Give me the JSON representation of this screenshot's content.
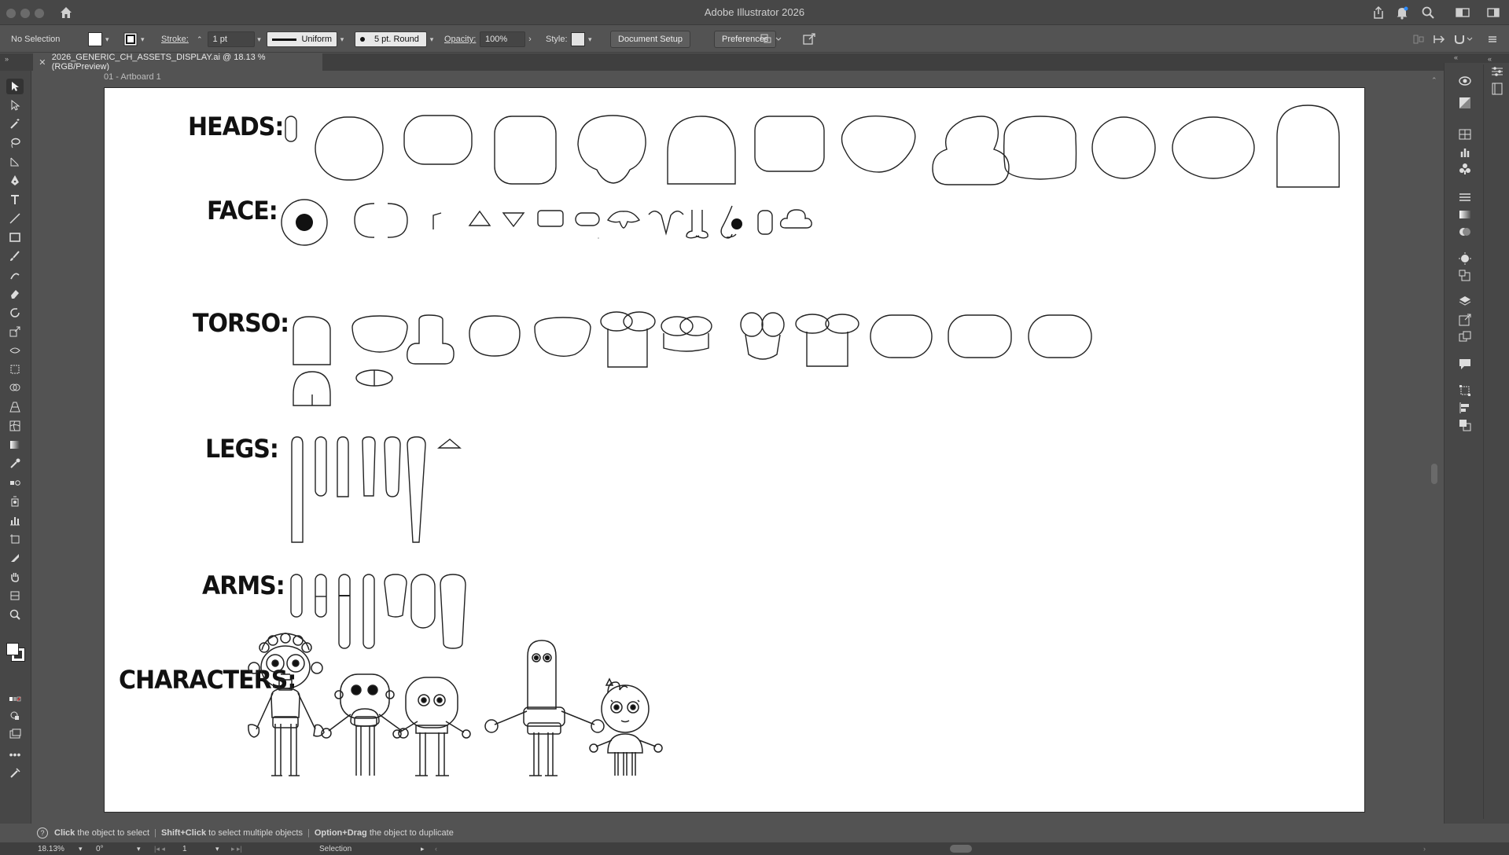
{
  "window": {
    "title": "Adobe Illustrator 2026"
  },
  "controlbar": {
    "selection": "No Selection",
    "stroke_label": "Stroke:",
    "stroke_weight": "1 pt",
    "profile": "Uniform",
    "brush": "5 pt. Round",
    "opacity_label": "Opacity:",
    "opacity_value": "100%",
    "style_label": "Style:",
    "document_setup": "Document Setup",
    "preferences": "Preferences"
  },
  "document": {
    "tab_title": "2026_GENERIC_CH_ASSETS_DISPLAY.ai @ 18.13 % (RGB/Preview)",
    "artboard_label": "01 - Artboard 1"
  },
  "artboard": {
    "categories": {
      "heads": "HEADS:",
      "face": "FACE:",
      "torso": "TORSO:",
      "legs": "LEGS:",
      "arms": "ARMS:",
      "characters": "CHARACTERS:"
    }
  },
  "hint": {
    "part1_bold": "Click",
    "part1": " the object to select",
    "part2_bold": "Shift+Click",
    "part2": " to select multiple objects",
    "part3_bold": "Option+Drag",
    "part3": " the object to duplicate"
  },
  "status": {
    "zoom": "18.13%",
    "rotation": "0°",
    "artboard_number": "1",
    "tool": "Selection"
  },
  "icons": [
    "home-icon",
    "share-icon",
    "bell-icon",
    "search-icon",
    "workspace-icon",
    "selection-tool-icon",
    "direct-selection-tool-icon",
    "pen-tool-icon",
    "type-tool-icon",
    "rectangle-tool-icon",
    "zoom-tool-icon",
    "hand-tool-icon",
    "layers-icon",
    "properties-icon"
  ],
  "colors": {
    "ui_dark": "#474747",
    "ui_mid": "#535353",
    "artboard": "#ffffff",
    "ink": "#111111"
  }
}
